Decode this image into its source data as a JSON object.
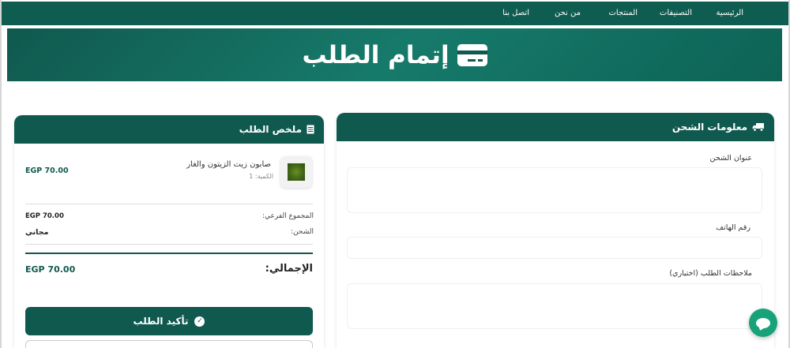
{
  "nav": {
    "items": [
      {
        "label": "الرئيسية"
      },
      {
        "label": "التصنيفات"
      },
      {
        "label": "المنتجات"
      },
      {
        "label": "من نحن"
      },
      {
        "label": "اتصل بنا"
      }
    ]
  },
  "hero": {
    "title": "إتمام الطلب",
    "icon": "credit-card-icon"
  },
  "shipping": {
    "header": "معلومات الشحن",
    "icon": "truck-icon",
    "address_label": "عنوان الشحن",
    "address_value": "",
    "phone_label": "رقم الهاتف",
    "phone_value": "",
    "notes_label": "ملاحظات الطلب (اختياري)",
    "notes_value": ""
  },
  "summary": {
    "header": "ملخص الطلب",
    "icon": "receipt-icon",
    "item": {
      "name": "صابون زيت الزيتون والغار",
      "quantity": "الكمية: 1",
      "price": "EGP 70.00"
    },
    "subtotal_label": "المجموع الفرعي:",
    "subtotal_value": "EGP 70.00",
    "shipping_label": "الشحن:",
    "shipping_value": "مجاني",
    "total_label": "الإجمالي:",
    "total_value": "EGP 70.00",
    "confirm_label": "تأكيد الطلب"
  },
  "colors": {
    "primary": "#10594f",
    "accent": "#17a27a"
  },
  "chat": {
    "icon": "chat-bubble-icon"
  }
}
